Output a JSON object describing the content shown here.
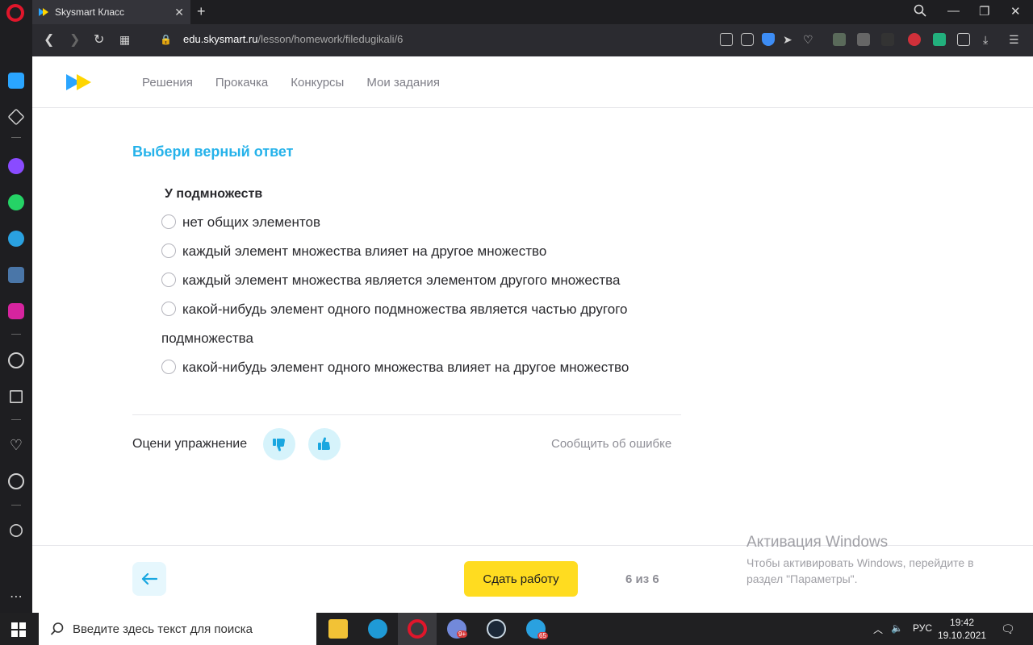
{
  "browser": {
    "tab_title": "Skysmart Класс",
    "url_host": "edu.skysmart.ru",
    "url_path": "/lesson/homework/filedugikali/6"
  },
  "site": {
    "nav": [
      "Решения",
      "Прокачка",
      "Конкурсы",
      "Мои задания"
    ]
  },
  "task": {
    "title": "Выбери верный ответ",
    "question": "У подмножеств",
    "options": [
      "нет общих элементов",
      "каждый элемент множества влияет на другое множество",
      "каждый элемент множества является элементом другого множества",
      "какой-нибудь элемент одного подмножества является частью другого подмножества",
      "какой-нибудь элемент одного множества влияет на другое множество"
    ]
  },
  "rating": {
    "label": "Оцени упражнение",
    "report": "Сообщить об ошибке"
  },
  "footer": {
    "submit": "Сдать работу",
    "progress": "6 из 6"
  },
  "watermark": {
    "title": "Активация Windows",
    "text": "Чтобы активировать Windows, перейдите в раздел \"Параметры\"."
  },
  "taskbar": {
    "search_placeholder": "Введите здесь текст для поиска",
    "language": "РУС",
    "time": "19:42",
    "date": "19.10.2021",
    "discord_badge": "9+",
    "telegram_badge": "65"
  },
  "colors": {
    "accent": "#25b2ea",
    "submit": "#ffdc20",
    "opera": "#e0162b"
  }
}
